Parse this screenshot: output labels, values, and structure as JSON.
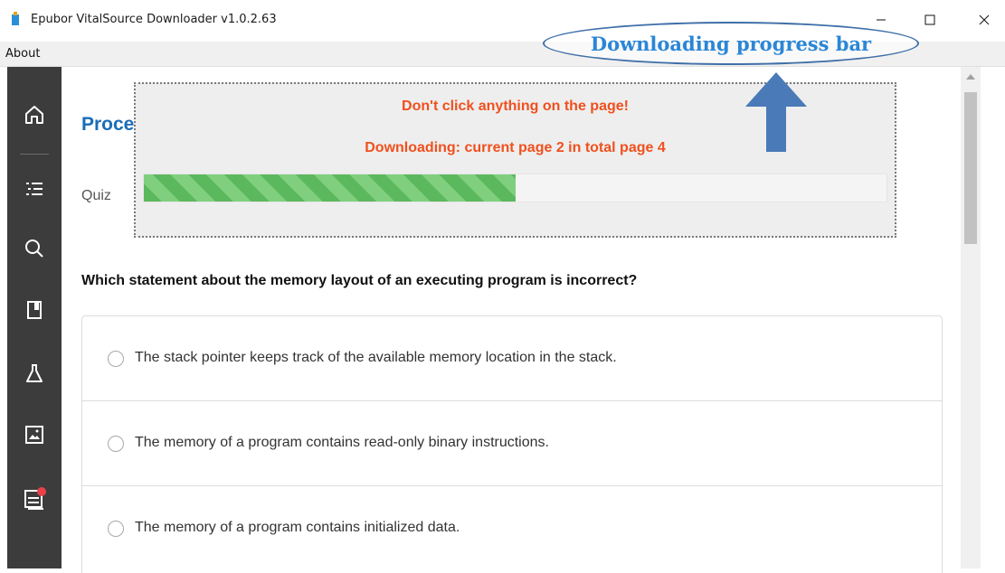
{
  "window": {
    "title": "Epubor VitalSource Downloader v1.0.2.63",
    "min_glyph": "—",
    "max_glyph": "☐",
    "close_glyph": "✕"
  },
  "menu": {
    "items": [
      {
        "label": "About"
      }
    ]
  },
  "sidebar": {
    "items": [
      {
        "icon": "home-icon"
      },
      {
        "icon": "list-icon"
      },
      {
        "icon": "search-icon"
      },
      {
        "icon": "bookmark-icon"
      },
      {
        "icon": "flask-icon"
      },
      {
        "icon": "image-icon"
      },
      {
        "icon": "notes-icon",
        "badge_color": "#e8414a"
      }
    ]
  },
  "main": {
    "heading": "Proce",
    "quiz_label": "Quiz",
    "question": "Which statement about the memory layout of an executing program is incorrect?",
    "answers": [
      {
        "text": "The stack pointer keeps track of the available memory location in the stack."
      },
      {
        "text": "The memory of a program contains read-only binary instructions."
      },
      {
        "text": "The memory of a program contains initialized data."
      }
    ]
  },
  "overlay": {
    "warning": "Don't click anything on the page!",
    "status": "Downloading: current page 2 in total page 4",
    "progress_fraction": 0.5,
    "current_page": 2,
    "total_pages": 4
  },
  "annotation": {
    "label": "Downloading progress bar"
  },
  "colors": {
    "accent": "#1a6db8",
    "warning": "#f0501e",
    "progress": "#5cb85c",
    "sidebar": "#3c3c3c",
    "callout": "#2b86d6"
  }
}
